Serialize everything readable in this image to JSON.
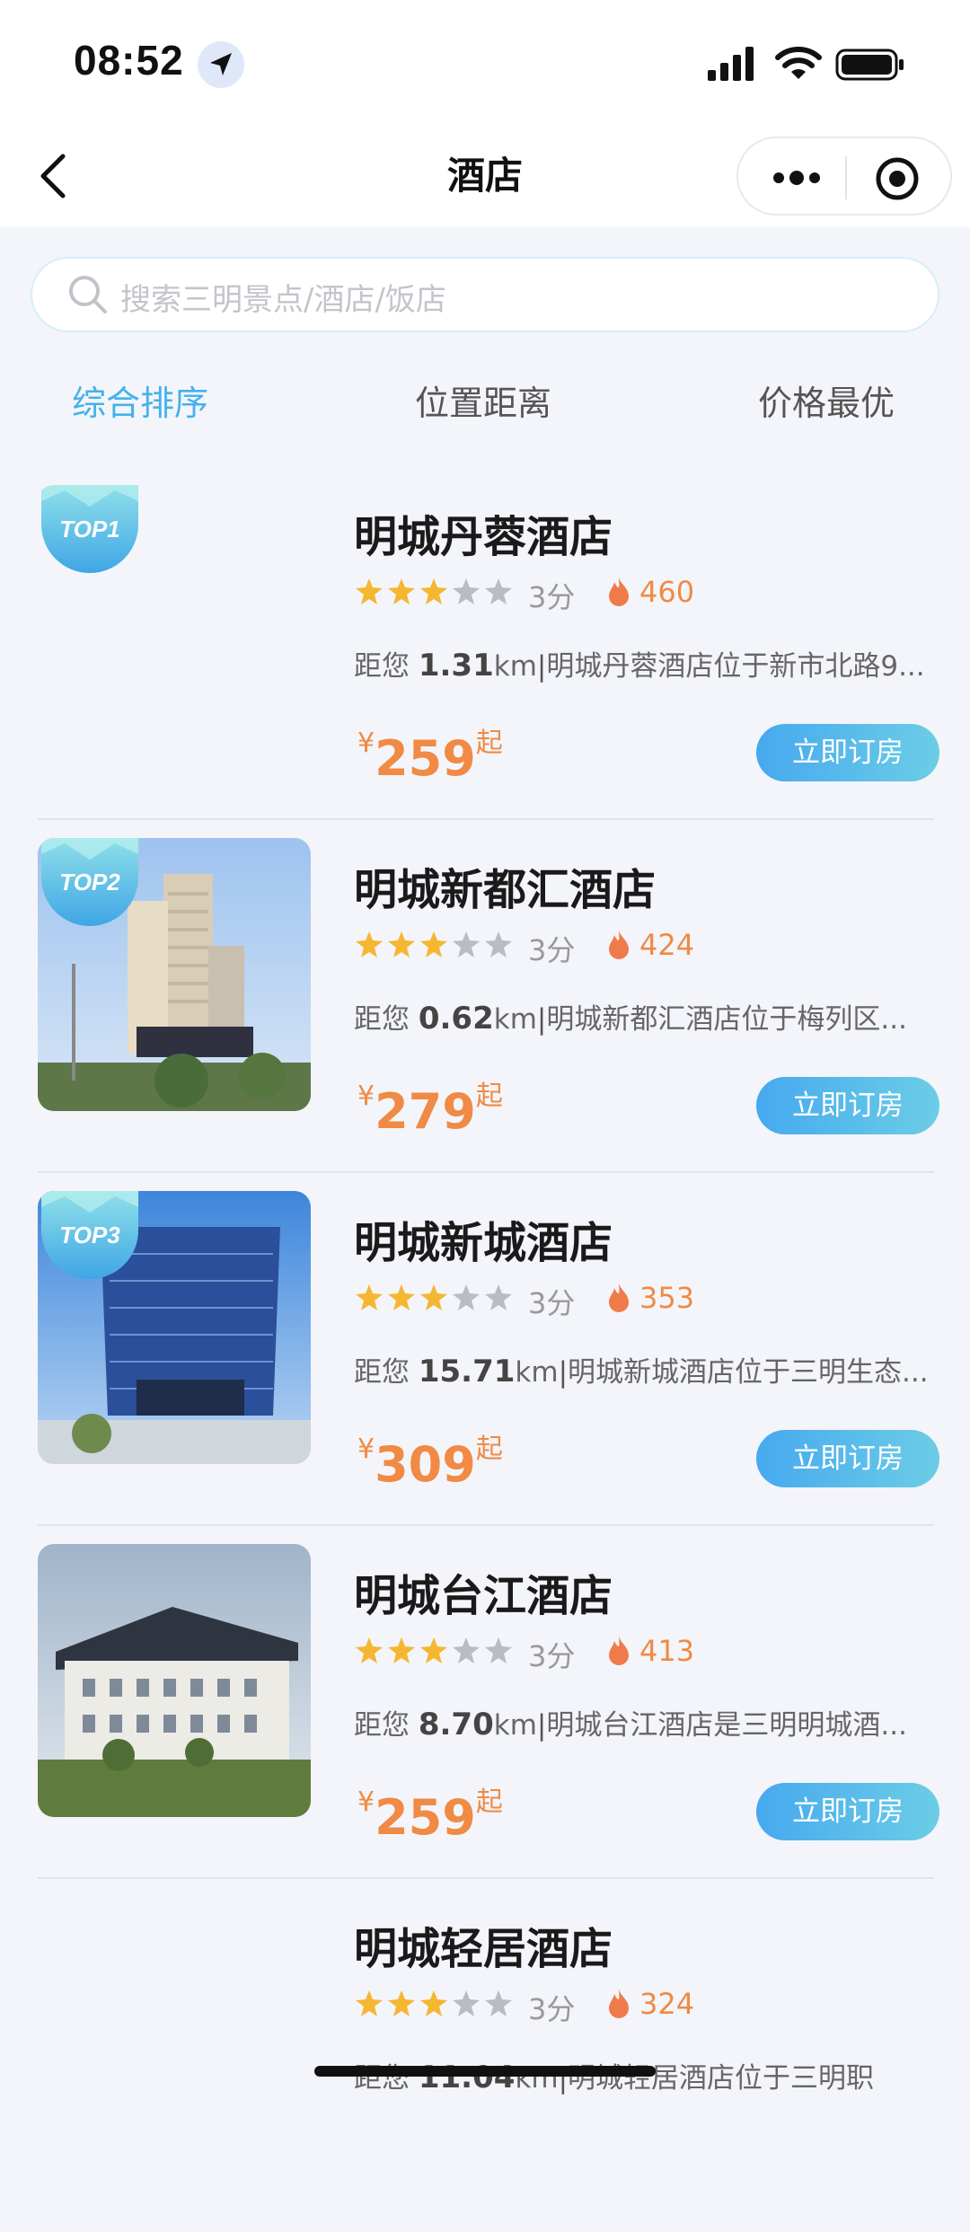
{
  "status": {
    "time": "08:52"
  },
  "nav": {
    "title": "酒店"
  },
  "search": {
    "placeholder": "搜索三明景点/酒店/饭店"
  },
  "sort_tabs": [
    {
      "label": "综合排序",
      "active": true
    },
    {
      "label": "位置距离",
      "active": false
    },
    {
      "label": "价格最优",
      "active": false
    }
  ],
  "hotels": [
    {
      "name": "明城丹蓉酒店",
      "badge": "TOP1",
      "stars": 3,
      "score": "3分",
      "heat": "460",
      "distance_prefix": "距您",
      "distance": "1.31",
      "unit": "km",
      "desc": "明城丹蓉酒店位于新市北路9...",
      "currency": "¥",
      "price": "259",
      "price_suffix": "起",
      "book_label": "立即订房",
      "has_image": false
    },
    {
      "name": "明城新都汇酒店",
      "badge": "TOP2",
      "stars": 3,
      "score": "3分",
      "heat": "424",
      "distance_prefix": "距您",
      "distance": "0.62",
      "unit": "km",
      "desc": "明城新都汇酒店位于梅列区...",
      "currency": "¥",
      "price": "279",
      "price_suffix": "起",
      "book_label": "立即订房",
      "has_image": true
    },
    {
      "name": "明城新城酒店",
      "badge": "TOP3",
      "stars": 3,
      "score": "3分",
      "heat": "353",
      "distance_prefix": "距您",
      "distance": "15.71",
      "unit": "km",
      "desc": "明城新城酒店位于三明生态...",
      "currency": "¥",
      "price": "309",
      "price_suffix": "起",
      "book_label": "立即订房",
      "has_image": true
    },
    {
      "name": "明城台江酒店",
      "badge": "",
      "stars": 3,
      "score": "3分",
      "heat": "413",
      "distance_prefix": "距您",
      "distance": "8.70",
      "unit": "km",
      "desc": "明城台江酒店是三明明城酒...",
      "currency": "¥",
      "price": "259",
      "price_suffix": "起",
      "book_label": "立即订房",
      "has_image": true
    },
    {
      "name": "明城轻居酒店",
      "badge": "",
      "stars": 3,
      "score": "3分",
      "heat": "324",
      "distance_prefix": "距您",
      "distance": "11.04",
      "unit": "km",
      "desc": "明城轻居酒店位于三明职",
      "currency": "¥",
      "price": "",
      "price_suffix": "",
      "book_label": "",
      "has_image": false
    }
  ],
  "colors": {
    "accent": "#44b2ea",
    "price": "#f08a44",
    "star_on": "#f5b731",
    "star_off": "#b9bcc2"
  }
}
